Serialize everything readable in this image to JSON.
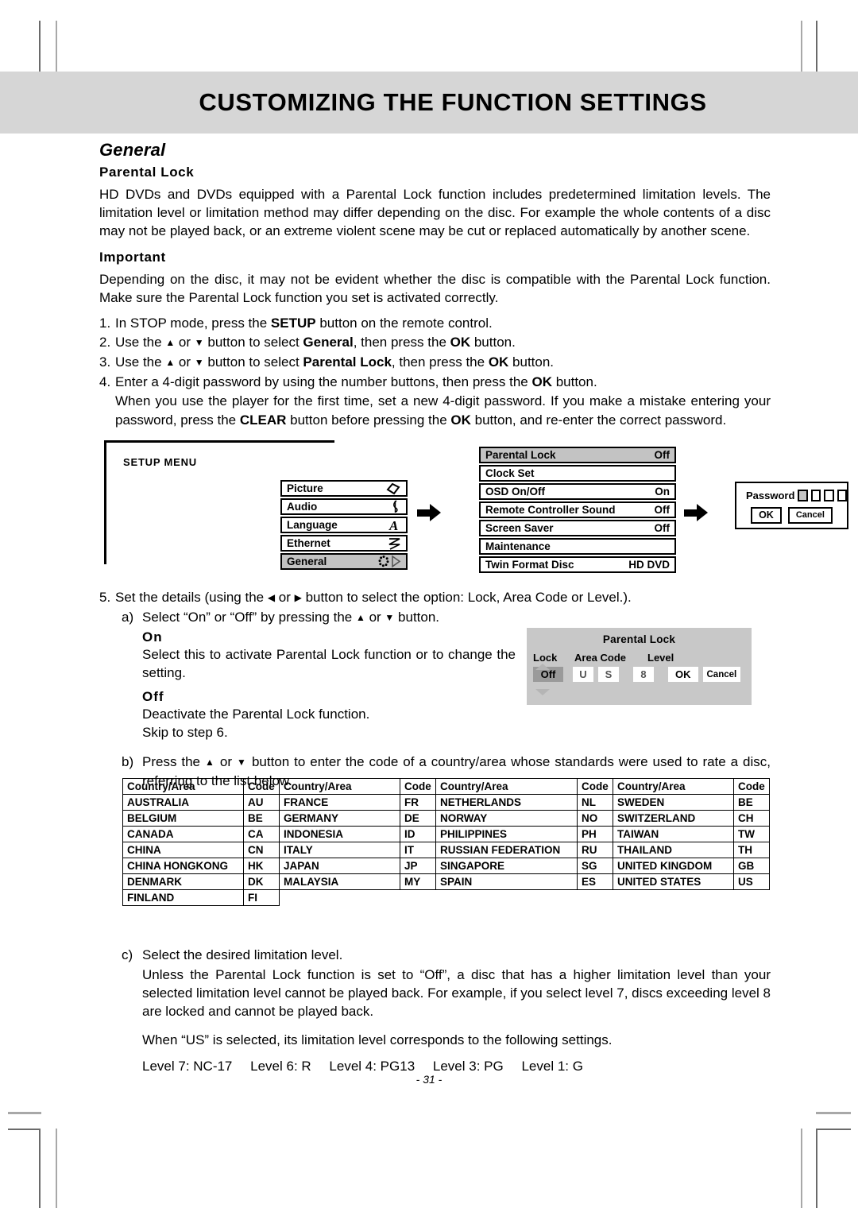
{
  "page": {
    "title": "CUSTOMIZING THE FUNCTION SETTINGS",
    "number": "- 31 -"
  },
  "section": {
    "heading": "General",
    "subheading": "Parental Lock",
    "intro": "HD DVDs and DVDs equipped with a Parental Lock function includes predetermined limitation levels. The limitation level or limitation method may differ depending on the disc. For example the whole contents of a disc may not be played back, or an extreme violent scene may be cut or replaced automatically by another scene.",
    "important_heading": "Important",
    "important_text": "Depending on the disc, it may not be evident whether the disc is compatible with the Parental Lock function. Make sure the Parental Lock function you set is activated correctly."
  },
  "steps": {
    "s1_num": "1.",
    "s1_a": "In STOP mode, press the ",
    "s1_b": "SETUP",
    "s1_c": " button on the remote control.",
    "s2_num": "2.",
    "s2_a": "Use the ",
    "s2_up": "▲",
    "s2_or": " or ",
    "s2_dn": "▼",
    "s2_b": " button to select ",
    "s2_bold": "General",
    "s2_c": ", then press the ",
    "s2_ok": "OK",
    "s2_d": " button.",
    "s3_num": "3.",
    "s3_bold": "Parental Lock",
    "s4_num": "4.",
    "s4_a": "Enter a 4-digit password by using the number buttons, then press the ",
    "s4_ok": "OK",
    "s4_b": " button.",
    "s4_c1": "When you use the player for the first time, set a new 4-digit password. If you make a mistake entering your password, press the ",
    "s4_clear": "CLEAR",
    "s4_c2": " button before pressing the ",
    "s4_ok2": "OK",
    "s4_c3": " button, and re-enter the correct password.",
    "s5_num": "5.",
    "s5_a": "Set the details (using the ",
    "s5_left": "◀",
    "s5_or": " or ",
    "s5_right": "▶",
    "s5_b": " button to select the option: Lock, Area Code or Level.).",
    "sa_num": "a)",
    "sa_a": "Select “On” or “Off” by pressing the ",
    "sa_b": " button.",
    "on_label": "On",
    "on_text": "Select this to activate Parental Lock function or to change the setting.",
    "off_label": "Off",
    "off_text": "Deactivate the Parental Lock function.",
    "off_text2": "Skip to step 6.",
    "sb_num": "b)",
    "sb_a": "Press the ",
    "sb_b": " button to enter the code of a country/area whose standards were used to rate a disc, referring to the list below.",
    "sc_num": "c)",
    "sc_a": "Select the desired limitation level.",
    "sc_b": "Unless the Parental Lock function is set to “Off”, a disc that has a higher limitation level than your selected limitation level cannot be played back. For example, if you select level 7, discs exceeding level 8 are locked and cannot be played back.",
    "sc_c": "When “US” is selected, its limitation level corresponds to the following settings."
  },
  "levels": [
    "Level 7: NC-17",
    "Level 6: R",
    "Level 4: PG13",
    "Level 3: PG",
    "Level 1: G"
  ],
  "diagram": {
    "setup_menu_label": "SETUP MENU",
    "setup_items": [
      {
        "label": "Picture",
        "icon": "diamond-icon",
        "glyph": "◇",
        "selected": false
      },
      {
        "label": "Audio",
        "icon": "music-note-icon",
        "glyph": "♪",
        "selected": false
      },
      {
        "label": "Language",
        "icon": "letter-a-icon",
        "glyph": "A",
        "selected": false
      },
      {
        "label": "Ethernet",
        "icon": "zigzag-icon",
        "glyph": "≈",
        "selected": false
      },
      {
        "label": "General",
        "icon": "gear-icon",
        "glyph": "✹",
        "selected": true
      }
    ],
    "general_items": [
      {
        "label": "Parental Lock",
        "value": "Off",
        "selected": true
      },
      {
        "label": "Clock Set",
        "value": "",
        "selected": false
      },
      {
        "label": "OSD On/Off",
        "value": "On",
        "selected": false
      },
      {
        "label": "Remote Controller Sound",
        "value": "Off",
        "selected": false
      },
      {
        "label": "Screen Saver",
        "value": "Off",
        "selected": false
      },
      {
        "label": "Maintenance",
        "value": "",
        "selected": false
      },
      {
        "label": "Twin Format Disc",
        "value": "HD DVD",
        "selected": false
      }
    ],
    "password": {
      "label": "Password",
      "digits": [
        "filled",
        "empty",
        "empty",
        "empty"
      ],
      "ok": "OK",
      "cancel": "Cancel"
    }
  },
  "osd": {
    "title": "Parental Lock",
    "headers": [
      "Lock",
      "Area Code",
      "Level"
    ],
    "lock_value": "Off",
    "area_code": [
      "U",
      "S"
    ],
    "level": "8",
    "ok": "OK",
    "cancel": "Cancel"
  },
  "country_table": {
    "header": [
      "Country/Area",
      "Code",
      "Country/Area",
      "Code",
      "Country/Area",
      "Code",
      "Country/Area",
      "Code"
    ],
    "rows": [
      [
        "AUSTRALIA",
        "AU",
        "FRANCE",
        "FR",
        "NETHERLANDS",
        "NL",
        "SWEDEN",
        "BE"
      ],
      [
        "BELGIUM",
        "BE",
        "GERMANY",
        "DE",
        "NORWAY",
        "NO",
        "SWITZERLAND",
        "CH"
      ],
      [
        "CANADA",
        "CA",
        "INDONESIA",
        "ID",
        "PHILIPPINES",
        "PH",
        "TAIWAN",
        "TW"
      ],
      [
        "CHINA",
        "CN",
        "ITALY",
        "IT",
        "RUSSIAN FEDERATION",
        "RU",
        "THAILAND",
        "TH"
      ],
      [
        "CHINA HONGKONG",
        "HK",
        "JAPAN",
        "JP",
        "SINGAPORE",
        "SG",
        "UNITED KINGDOM",
        "GB"
      ],
      [
        "DENMARK",
        "DK",
        "MALAYSIA",
        "MY",
        "SPAIN",
        "ES",
        "UNITED STATES",
        "US"
      ],
      [
        "FINLAND",
        "FI",
        "",
        "",
        "",
        "",
        "",
        ""
      ]
    ]
  }
}
